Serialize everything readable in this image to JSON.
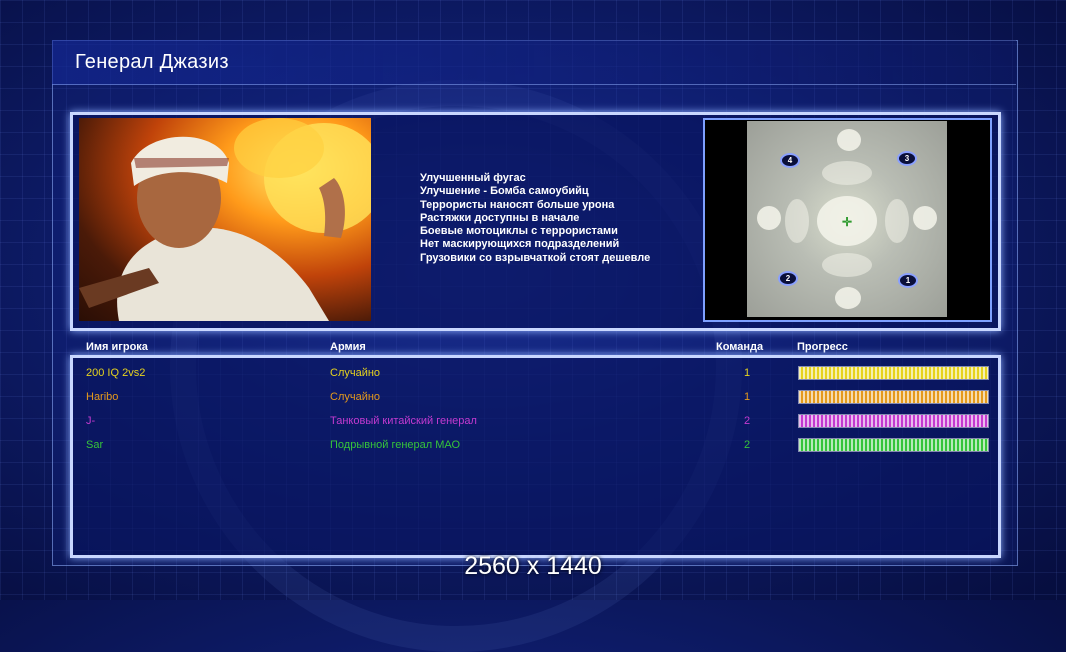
{
  "title": "Генерал Джазиз",
  "bullets": [
    "Улучшенный фугас",
    "Улучшение - Бомба самоубийц",
    "Террористы наносят больше урона",
    "Растяжки доступны в начале",
    "Боевые мотоциклы с террористами",
    "Нет маскирующихся подразделений",
    "Грузовики со взрывчаткой стоят дешевле"
  ],
  "minimap": {
    "start_positions": [
      "4",
      "3",
      "2",
      "1"
    ]
  },
  "table": {
    "headers": {
      "player": "Имя игрока",
      "army": "Армия",
      "team": "Команда",
      "progress": "Прогресс"
    },
    "rows": [
      {
        "name": "200 IQ 2vs2",
        "army": "Случайно",
        "team": "1",
        "color": "#e6d31e",
        "progress": 1.0
      },
      {
        "name": "Haribo",
        "army": "Случайно",
        "team": "1",
        "color": "#e59a1c",
        "progress": 1.0
      },
      {
        "name": "J-",
        "army": "Танковый китайский генерал",
        "team": "2",
        "color": "#c43ad0",
        "progress": 1.0
      },
      {
        "name": "Sar",
        "army": "Подрывной генерал МАО",
        "team": "2",
        "color": "#36c43a",
        "progress": 1.0
      }
    ]
  },
  "resolution_label": "2560 x 1440"
}
